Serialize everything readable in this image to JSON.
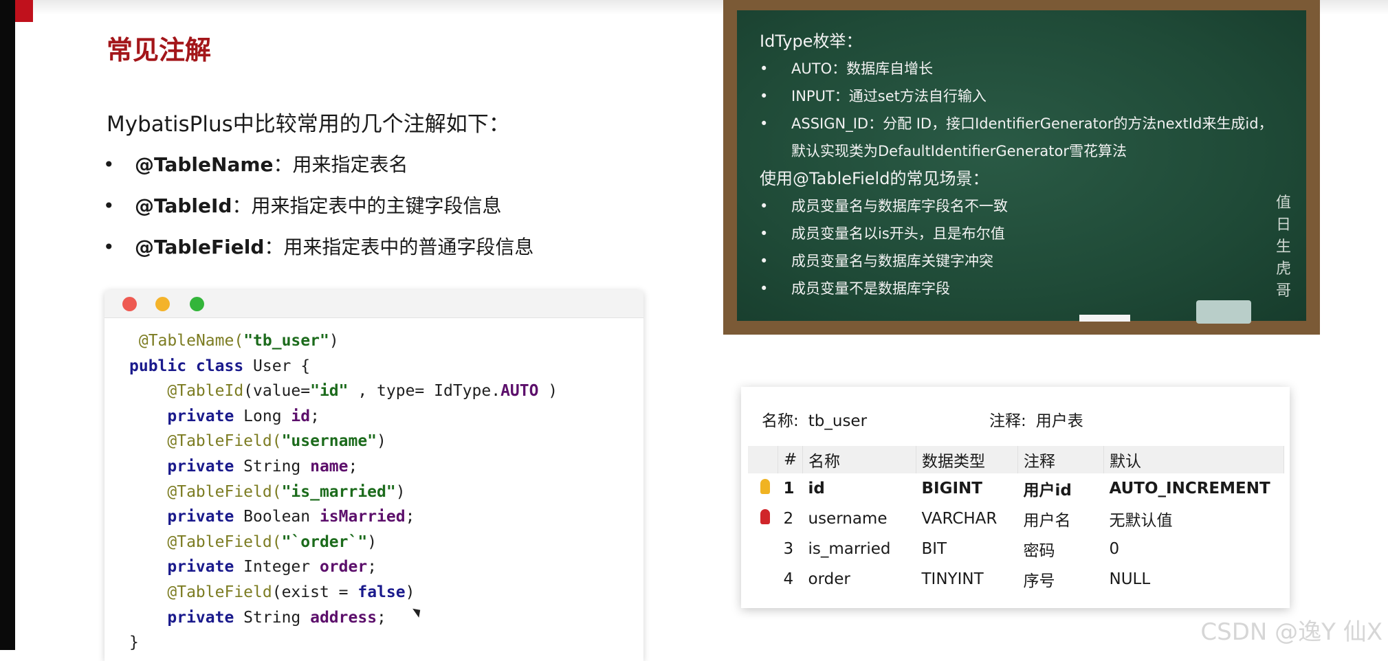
{
  "slide": {
    "title": "常见注解",
    "intro": "MybatisPlus中比较常用的几个注解如下：",
    "bullets": [
      {
        "key": "@TableName",
        "desc": "：用来指定表名"
      },
      {
        "key": "@TableId",
        "desc": "：用来指定表中的主键字段信息"
      },
      {
        "key": "@TableField",
        "desc": "：用来指定表中的普通字段信息"
      }
    ]
  },
  "code": {
    "l1_ann": "@TableName(",
    "l1_str": "\"tb_user\"",
    "l1_end": ")",
    "l2_kw": "public class",
    "l2_rest": " User {",
    "l3_ann": "@TableId",
    "l3_a": "(value=",
    "l3_str": "\"id\"",
    "l3_b": " , type= IdType.",
    "l3_auto": "AUTO",
    "l3_end": " )",
    "l4_kw": "private",
    "l4_type": " Long ",
    "l4_fld": "id",
    "l4_end": ";",
    "l5_ann": "@TableField(",
    "l5_str": "\"username\"",
    "l5_end": ")",
    "l6_kw": "private",
    "l6_type": " String ",
    "l6_fld": "name",
    "l6_end": ";",
    "l7_ann": "@TableField(",
    "l7_str": "\"is_married\"",
    "l7_end": ")",
    "l8_kw": "private",
    "l8_type": " Boolean ",
    "l8_fld": "isMarried",
    "l8_end": ";",
    "l9_ann": "@TableField(",
    "l9_str": "\"`order`\"",
    "l9_end": ")",
    "l10_kw": "private",
    "l10_type": " Integer ",
    "l10_fld": "order",
    "l10_end": ";",
    "l11_ann": "@TableField",
    "l11_a": "(exist = ",
    "l11_kw": "false",
    "l11_end": ")",
    "l12_kw": "private",
    "l12_type": " String ",
    "l12_fld": "address",
    "l12_end": ";",
    "l13": "}"
  },
  "board": {
    "heading1": "IdType枚举：",
    "items1": [
      "AUTO：数据库自增长",
      "INPUT：通过set方法自行输入",
      "ASSIGN_ID：分配 ID，接口IdentifierGenerator的方法nextId来生成id，",
      "默认实现类为DefaultIdentifierGenerator雪花算法"
    ],
    "heading2": "使用@TableField的常见场景：",
    "items2": [
      "成员变量名与数据库字段名不一致",
      "成员变量名以is开头，且是布尔值",
      "成员变量名与数据库关键字冲突",
      "成员变量不是数据库字段"
    ],
    "signature": "值日生虎哥"
  },
  "db": {
    "name_label": "名称:",
    "name_value": "tb_user",
    "comment_label": "注释:",
    "comment_value": "用户表",
    "headers": [
      "#",
      "名称",
      "数据类型",
      "注释",
      "默认"
    ],
    "rows": [
      {
        "num": "1",
        "name": "id",
        "type": "BIGINT",
        "comment": "用户id",
        "default": "AUTO_INCREMENT"
      },
      {
        "num": "2",
        "name": "username",
        "type": "VARCHAR",
        "comment": "用户名",
        "default": "无默认值"
      },
      {
        "num": "3",
        "name": "is_married",
        "type": "BIT",
        "comment": "密码",
        "default": "0"
      },
      {
        "num": "4",
        "name": "order",
        "type": "TINYINT",
        "comment": "序号",
        "default": "NULL"
      }
    ]
  },
  "watermark": "CSDN @逸Y  仙X"
}
